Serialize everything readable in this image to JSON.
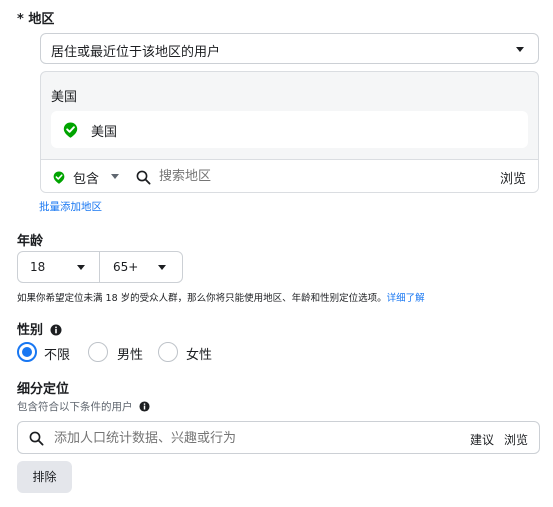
{
  "location": {
    "section_label": "* 地区",
    "type_select": "居住或最近位于该地区的用户",
    "group_label": "美国",
    "selected_item": "美国",
    "include_label": "包含",
    "search_placeholder": "搜索地区",
    "browse_label": "浏览",
    "bulk_add_link": "批量添加地区"
  },
  "age": {
    "section_label": "年龄",
    "min": "18",
    "max": "65+",
    "note": "如果你希望定位未满 18 岁的受众人群，那么你将只能使用地区、年龄和性别定位选项。",
    "learn_more": "详细了解"
  },
  "gender": {
    "section_label": "性别",
    "options": [
      "不限",
      "男性",
      "女性"
    ],
    "selected": "不限"
  },
  "detailed_targeting": {
    "section_label": "细分定位",
    "sub_label": "包含符合以下条件的用户",
    "search_placeholder": "添加人口统计数据、兴趣或行为",
    "suggestions_label": "建议",
    "browse_label": "浏览",
    "exclude_button": "排除"
  },
  "colors": {
    "accent_blue": "#1877f2",
    "include_green": "#00a400",
    "text": "#1c1e21",
    "border": "#ccd0d5"
  }
}
